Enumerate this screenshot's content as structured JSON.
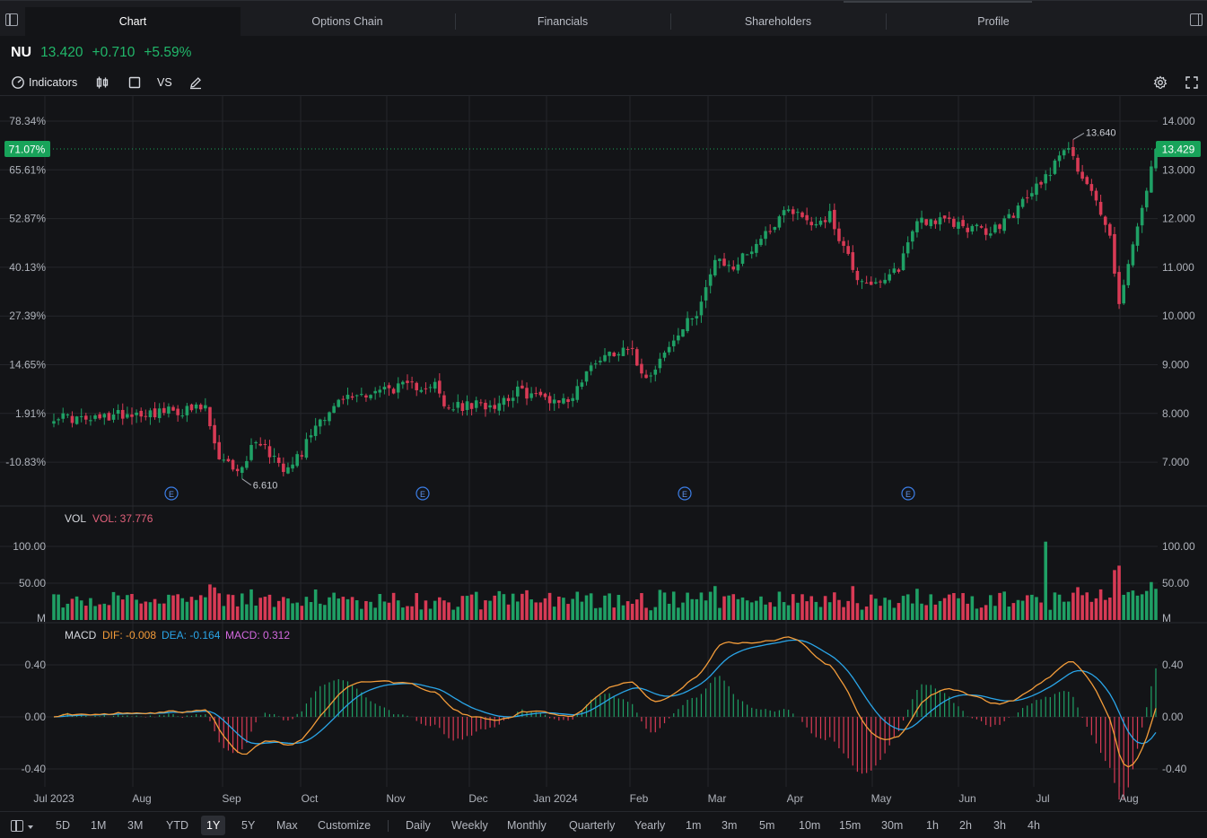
{
  "tabs": [
    {
      "label": "Chart",
      "active": true
    },
    {
      "label": "Options Chain",
      "active": false
    },
    {
      "label": "Financials",
      "active": false
    },
    {
      "label": "Shareholders",
      "active": false
    },
    {
      "label": "Profile",
      "active": false
    }
  ],
  "quote": {
    "symbol": "NU",
    "price": "13.420",
    "change": "+0.710",
    "change_pct": "+5.59%",
    "color": "#21b76a"
  },
  "toolbar": {
    "indicators_label": "Indicators",
    "vs_label": "VS",
    "icons": [
      "indicators-gauge-icon",
      "candlestick-type-icon",
      "rectangle-icon",
      "pencil-draw-icon",
      "settings-gear-icon",
      "fullscreen-icon"
    ]
  },
  "colors": {
    "up": "#1fa065",
    "down": "#d83a55",
    "background": "#131417",
    "grid": "#24262b",
    "dif": "#f39c3a",
    "dea": "#2aa5e8",
    "macd": "#d469e0",
    "accent": "#18a35a"
  },
  "chart_data": {
    "type": "candlestick",
    "symbol": "NU",
    "price_axis": {
      "ticks": [
        "14.000",
        "13.000",
        "12.000",
        "11.000",
        "10.000",
        "9.000",
        "8.000",
        "7.000"
      ],
      "range": [
        6.2,
        14.8
      ]
    },
    "percent_axis": {
      "ticks": [
        "78.34%",
        "65.61%",
        "52.87%",
        "40.13%",
        "27.39%",
        "14.65%",
        "1.91%",
        "-10.83%"
      ]
    },
    "last_price_label": "13.429",
    "last_percent_label": "71.07%",
    "high_marker": "13.640",
    "low_marker": "6.610",
    "earnings_marker": "E",
    "earnings_months": [
      "Aug",
      "Nov",
      "Feb",
      "May"
    ],
    "x_labels": [
      "Jul 2023",
      "Aug",
      "Sep",
      "Oct",
      "Nov",
      "Dec",
      "Jan 2024",
      "Feb",
      "Mar",
      "Apr",
      "May",
      "Jun",
      "Jul",
      "Aug"
    ],
    "anchors": [
      {
        "d": 0,
        "p": 7.95
      },
      {
        "d": 8,
        "p": 7.85
      },
      {
        "d": 15,
        "p": 8.0
      },
      {
        "d": 28,
        "p": 8.05
      },
      {
        "d": 33,
        "p": 8.1
      },
      {
        "d": 36,
        "p": 7.0
      },
      {
        "d": 41,
        "p": 6.85
      },
      {
        "d": 44,
        "p": 7.5
      },
      {
        "d": 50,
        "p": 6.9
      },
      {
        "d": 54,
        "p": 7.2
      },
      {
        "d": 57,
        "p": 7.8
      },
      {
        "d": 63,
        "p": 8.3
      },
      {
        "d": 72,
        "p": 8.5
      },
      {
        "d": 83,
        "p": 8.6
      },
      {
        "d": 85,
        "p": 8.1
      },
      {
        "d": 96,
        "p": 8.2
      },
      {
        "d": 101,
        "p": 8.45
      },
      {
        "d": 108,
        "p": 8.3
      },
      {
        "d": 112,
        "p": 8.25
      },
      {
        "d": 118,
        "p": 9.1
      },
      {
        "d": 125,
        "p": 9.4
      },
      {
        "d": 129,
        "p": 8.75
      },
      {
        "d": 134,
        "p": 9.35
      },
      {
        "d": 140,
        "p": 10.1
      },
      {
        "d": 144,
        "p": 11.1
      },
      {
        "d": 148,
        "p": 11.0
      },
      {
        "d": 155,
        "p": 11.7
      },
      {
        "d": 160,
        "p": 12.25
      },
      {
        "d": 165,
        "p": 11.9
      },
      {
        "d": 169,
        "p": 12.05
      },
      {
        "d": 175,
        "p": 10.8
      },
      {
        "d": 180,
        "p": 10.6
      },
      {
        "d": 184,
        "p": 11.0
      },
      {
        "d": 188,
        "p": 12.0
      },
      {
        "d": 196,
        "p": 11.9
      },
      {
        "d": 204,
        "p": 11.7
      },
      {
        "d": 210,
        "p": 12.2
      },
      {
        "d": 217,
        "p": 13.0
      },
      {
        "d": 220,
        "p": 13.5
      },
      {
        "d": 226,
        "p": 12.6
      },
      {
        "d": 230,
        "p": 11.6
      },
      {
        "d": 232,
        "p": 10.3
      },
      {
        "d": 235,
        "p": 11.4
      },
      {
        "d": 238,
        "p": 12.6
      },
      {
        "d": 240,
        "p": 13.43
      }
    ],
    "vol": {
      "label": "VOL",
      "value_label": "VOL: 37.776",
      "ticks": [
        "100.00",
        "50.00",
        "M"
      ],
      "max": 125
    },
    "macd": {
      "label": "MACD",
      "dif_label": "DIF: -0.008",
      "dea_label": "DEA: -0.164",
      "macd_label": "MACD: 0.312",
      "ticks": [
        "0.40",
        "0.00",
        "-0.40"
      ],
      "range": [
        -0.55,
        0.55
      ]
    }
  },
  "ranges": [
    "5D",
    "1M",
    "3M",
    "YTD",
    "1Y",
    "5Y",
    "Max",
    "Customize"
  ],
  "active_range": "1Y",
  "intervals": [
    "Daily",
    "Weekly",
    "Monthly",
    "Quarterly",
    "Yearly",
    "1m",
    "3m",
    "5m",
    "10m",
    "15m",
    "30m",
    "1h",
    "2h",
    "3h",
    "4h"
  ]
}
